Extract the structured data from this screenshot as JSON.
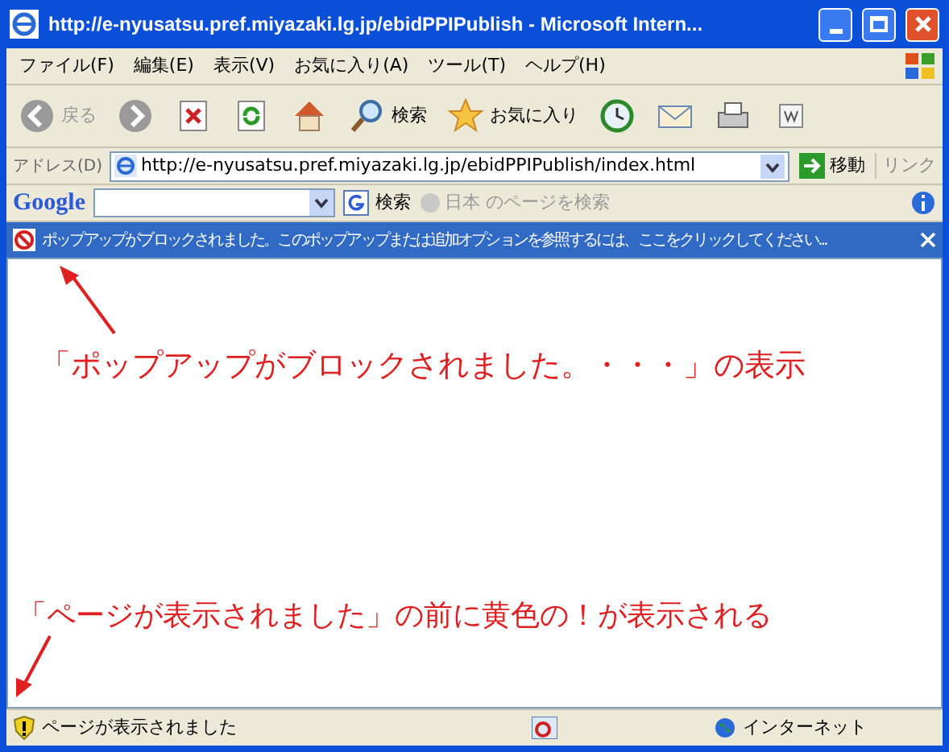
{
  "window": {
    "title": "http://e-nyusatsu.pref.miyazaki.lg.jp/ebidPPIPublish - Microsoft Intern..."
  },
  "menu": [
    "ファイル(F)",
    "編集(E)",
    "表示(V)",
    "お気に入り(A)",
    "ツール(T)",
    "ヘルプ(H)"
  ],
  "toolbar": [
    {
      "kind": "back",
      "label": "戻る",
      "disabled": true
    },
    {
      "kind": "forward",
      "disabled": true
    },
    {
      "kind": "stop"
    },
    {
      "kind": "refresh"
    },
    {
      "kind": "home"
    },
    {
      "kind": "search",
      "label": "検索"
    },
    {
      "kind": "favorites",
      "label": "お気に入り"
    },
    {
      "kind": "history"
    },
    {
      "kind": "mail"
    },
    {
      "kind": "print"
    },
    {
      "kind": "edit"
    }
  ],
  "address": {
    "label": "アドレス(D)",
    "value": "http://e-nyusatsu.pref.miyazaki.lg.jp/ebidPPIPublish/index.html",
    "go": "移動",
    "links": "リンク"
  },
  "google_toolbar": {
    "logo": "Google",
    "search": "検索",
    "page_search": {
      "label": "日本 のページを検索",
      "disabled": true
    }
  },
  "info_bar": {
    "text": "ポップアップがブロックされました。このポップアップまたは追加オプションを参照するには、ここをクリックしてください..."
  },
  "annotations": [
    "「ポップアップがブロックされました。・・・」の表示",
    "「ページが表示されました」の前に黄色の！が表示される"
  ],
  "status_bar": {
    "text": "ページが表示されました",
    "zone": "インターネット"
  }
}
